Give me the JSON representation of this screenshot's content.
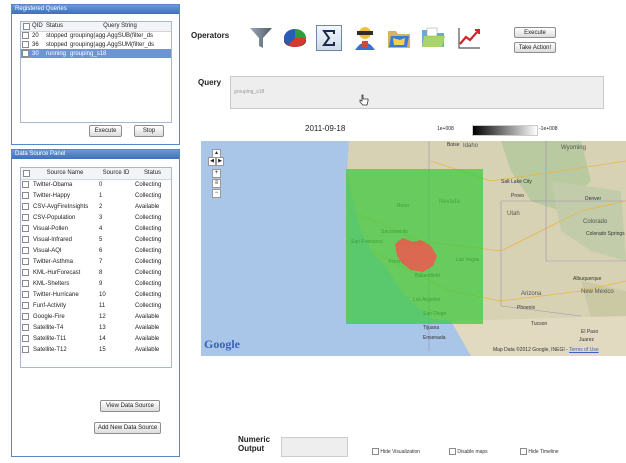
{
  "registered_queries": {
    "title": "Registered Queries",
    "columns": [
      "QID",
      "Status",
      "Query String"
    ],
    "rows": [
      {
        "qid": "20",
        "status": "stopped",
        "query": "grouping(agg.AggSUB(filter_ds"
      },
      {
        "qid": "36",
        "status": "stopped",
        "query": "grouping(agg.AggSUM(filter_ds"
      },
      {
        "qid": "30",
        "status": "running",
        "query": "grouping_s18"
      }
    ],
    "execute_label": "Execute",
    "stop_label": "Stop"
  },
  "data_source_panel": {
    "title": "Data Source Panel",
    "columns": [
      "Source Name",
      "Source ID",
      "Status"
    ],
    "rows": [
      {
        "name": "Twitter-Obama",
        "id": "0",
        "status": "Collecting"
      },
      {
        "name": "Twitter-Happy",
        "id": "1",
        "status": "Collecting"
      },
      {
        "name": "CSV-AvgFireInsights",
        "id": "2",
        "status": "Available"
      },
      {
        "name": "CSV-Population",
        "id": "3",
        "status": "Collecting"
      },
      {
        "name": "Visual-Pollen",
        "id": "4",
        "status": "Collecting"
      },
      {
        "name": "Visual-Infrared",
        "id": "5",
        "status": "Collecting"
      },
      {
        "name": "Visual-AQI",
        "id": "6",
        "status": "Collecting"
      },
      {
        "name": "Twitter-Asthma",
        "id": "7",
        "status": "Collecting"
      },
      {
        "name": "KML-HurForecast",
        "id": "8",
        "status": "Collecting"
      },
      {
        "name": "KML-Shelters",
        "id": "9",
        "status": "Collecting"
      },
      {
        "name": "Twitter-Hurricane",
        "id": "10",
        "status": "Collecting"
      },
      {
        "name": "Funf-Activity",
        "id": "11",
        "status": "Collecting"
      },
      {
        "name": "Google-Fire",
        "id": "12",
        "status": "Available"
      },
      {
        "name": "Satellite-T4",
        "id": "13",
        "status": "Available"
      },
      {
        "name": "Satellite-T11",
        "id": "14",
        "status": "Available"
      },
      {
        "name": "Satellite-T12",
        "id": "15",
        "status": "Available"
      }
    ],
    "view_label": "View Data Source",
    "add_label": "Add New Data Source"
  },
  "operators": {
    "label": "Operators",
    "icons": [
      "filter-icon",
      "pie-chart-icon",
      "sum-icon",
      "person-icon",
      "folder-map-icon",
      "folder-icon",
      "line-chart-icon"
    ],
    "execute_label": "Execute",
    "take_action_label": "Take Action!"
  },
  "query": {
    "label": "Query",
    "value": "grouping_s18"
  },
  "timeline": {
    "date": "2011-09-18",
    "legend_min": "1e+008",
    "legend_max": "-1e+008"
  },
  "map": {
    "logo": "Google",
    "attribution": "Map Data ©2012 Google, INEGI -",
    "terms": "Terms of Use",
    "states": [
      "Idaho",
      "Wyoming",
      "Utah",
      "Nevada",
      "Colorado",
      "Arizona",
      "New Mexico",
      "California"
    ],
    "cities": [
      "Boise",
      "Salt Lake City",
      "Denver",
      "Las Vegas",
      "Sacramento",
      "San Francisco",
      "Fresno",
      "Bakersfield",
      "Los Angeles",
      "San Diego",
      "Phoenix",
      "Tucson",
      "Albuquerque",
      "Reno",
      "Provo",
      "Tijuana",
      "Ensenada",
      "Colorado Springs",
      "El Paso",
      "Juarez"
    ]
  },
  "numeric_output": {
    "label_line1": "Numeric",
    "label_line2": "Output",
    "value": ""
  },
  "options": {
    "hide_visualization": "Hide Visualization",
    "disable_maps": "Disable maps",
    "hide_timeline": "Hide Timeline"
  },
  "colors": {
    "panel_header": "#4a7cc4",
    "selected_row": "#6d95d3",
    "overlay_green": "#3cc93c",
    "overlay_red": "#f0564e"
  }
}
